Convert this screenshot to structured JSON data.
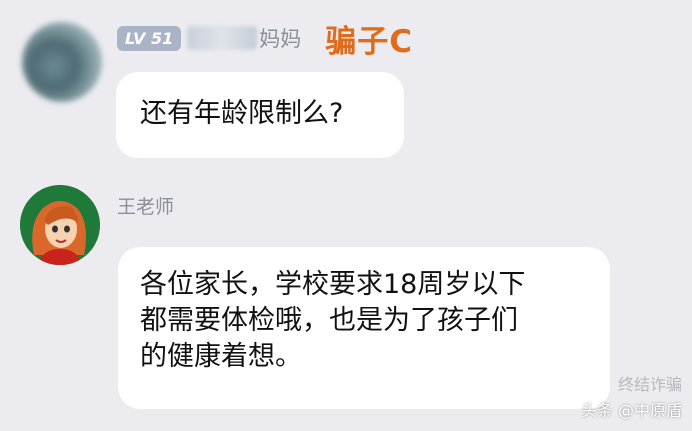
{
  "messages": [
    {
      "level_badge": "LV 51",
      "sender_suffix": "妈妈",
      "tag": "骗子C",
      "text": "还有年龄限制么?"
    },
    {
      "sender": "王老师",
      "text_lines": [
        "各位家长，学校要求18周岁以下",
        "都需要体检哦，也是为了孩子们",
        "的健康着想。"
      ]
    }
  ],
  "watermark": {
    "line1": "终结诈骗",
    "line2": "头条 @中原盾"
  }
}
